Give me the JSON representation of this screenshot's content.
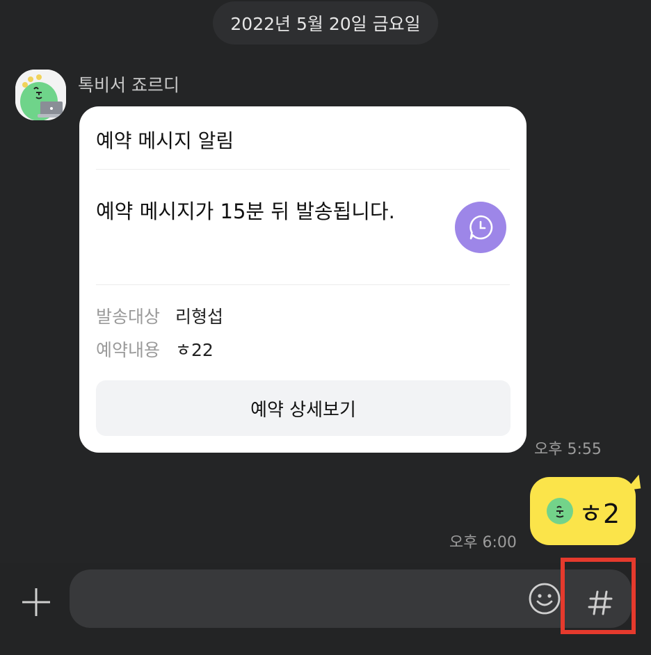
{
  "chat": {
    "date_label": "2022년 5월 20일 금요일",
    "sender_name": "톡비서 죠르디",
    "card": {
      "title": "예약 메시지 알림",
      "body": "예약 메시지가 15분 뒤 발송됩니다.",
      "recipient_label": "발송대상",
      "recipient_value": "리형섭",
      "content_label": "예약내용",
      "content_value": "ㅎ22",
      "detail_button": "예약 상세보기",
      "icon": "clock-icon"
    },
    "card_time": "오후 5:55",
    "my_message": {
      "text": "ㅎ2",
      "time": "오후 6:00",
      "emoticon": "jordy-face-icon"
    }
  },
  "input_bar": {
    "placeholder": "",
    "plus_icon": "plus-icon",
    "emoji_icon": "smiley-icon",
    "hash_icon": "hash-icon"
  },
  "colors": {
    "background": "#242526",
    "bubble": "#fbe44a",
    "accent_purple": "#9d86e8",
    "highlight": "#e53a2d"
  }
}
